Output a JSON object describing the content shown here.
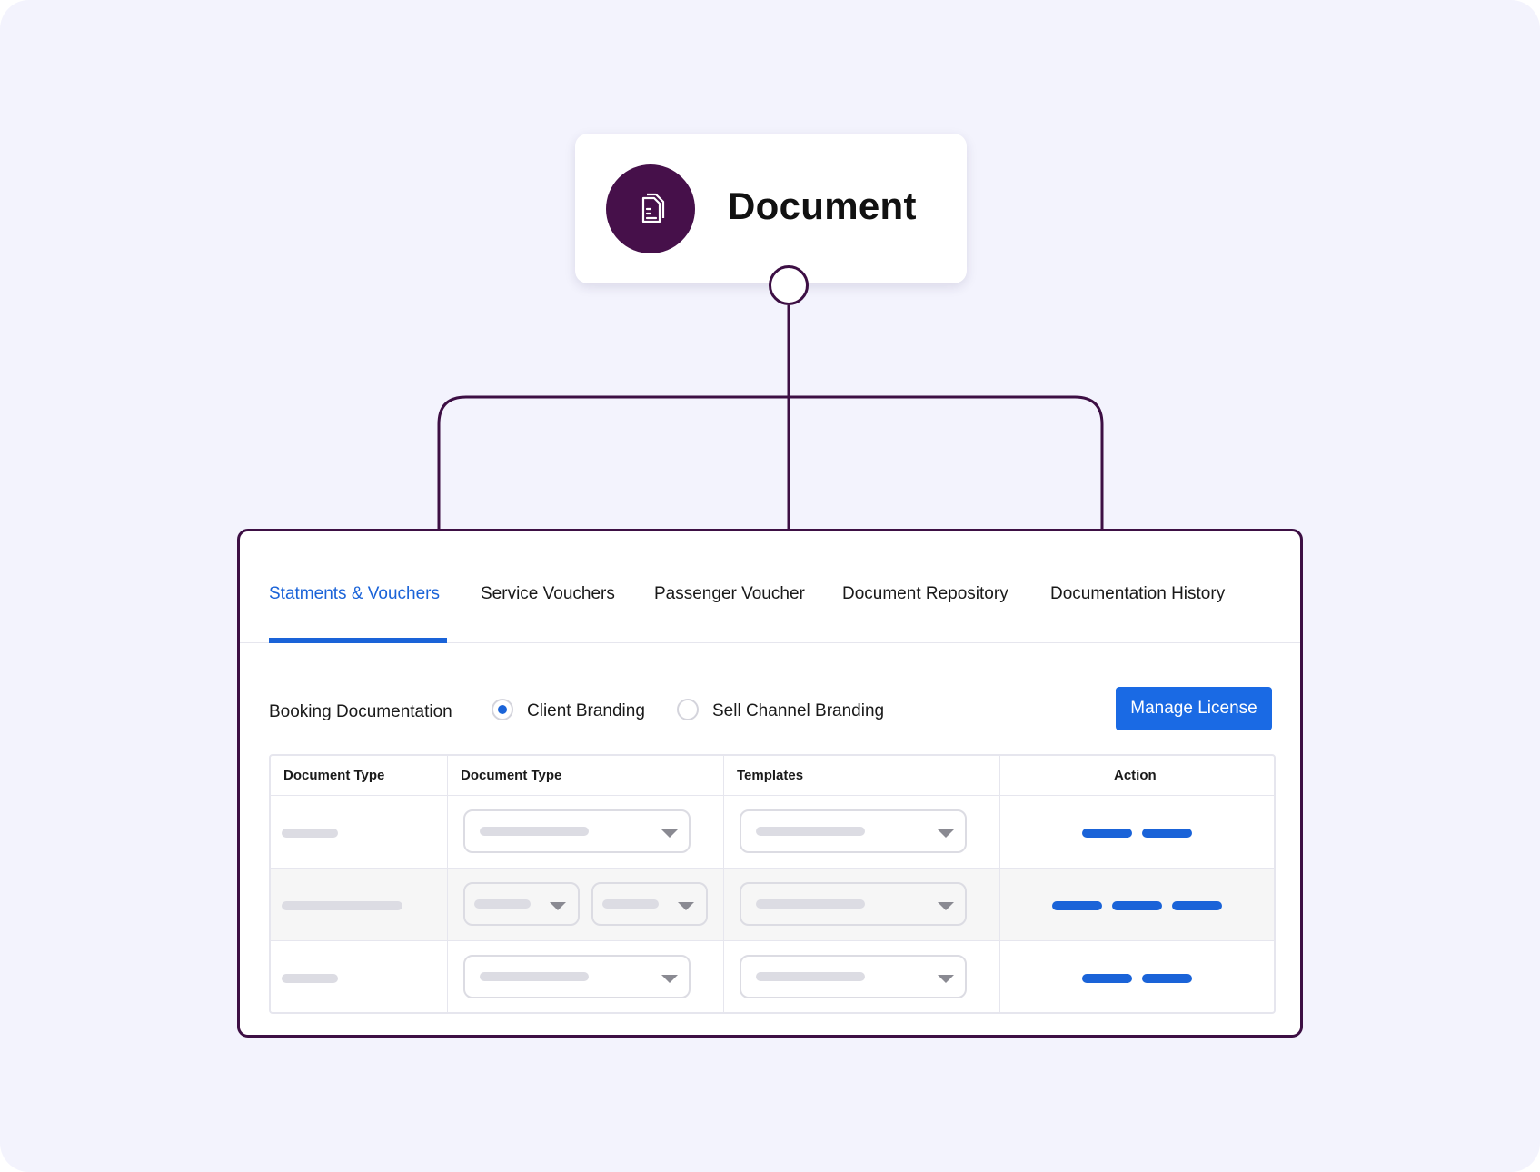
{
  "header_card": {
    "title": "Document",
    "icon": "document-icon"
  },
  "tabs": [
    {
      "label": "Statments & Vouchers",
      "active": true
    },
    {
      "label": "Service Vouchers",
      "active": false
    },
    {
      "label": "Passenger Voucher",
      "active": false
    },
    {
      "label": "Document Repository",
      "active": false
    },
    {
      "label": "Documentation History",
      "active": false
    }
  ],
  "booking": {
    "label": "Booking Documentation",
    "options": [
      {
        "label": "Client Branding",
        "selected": true
      },
      {
        "label": "Sell Channel Branding",
        "selected": false
      }
    ],
    "manage_button": "Manage License"
  },
  "table": {
    "headers": [
      "Document Type",
      "Document Type",
      "Templates",
      "Action"
    ]
  },
  "colors": {
    "accent": "#1a63d8",
    "brand": "#46104a",
    "background": "#f3f3fd"
  }
}
